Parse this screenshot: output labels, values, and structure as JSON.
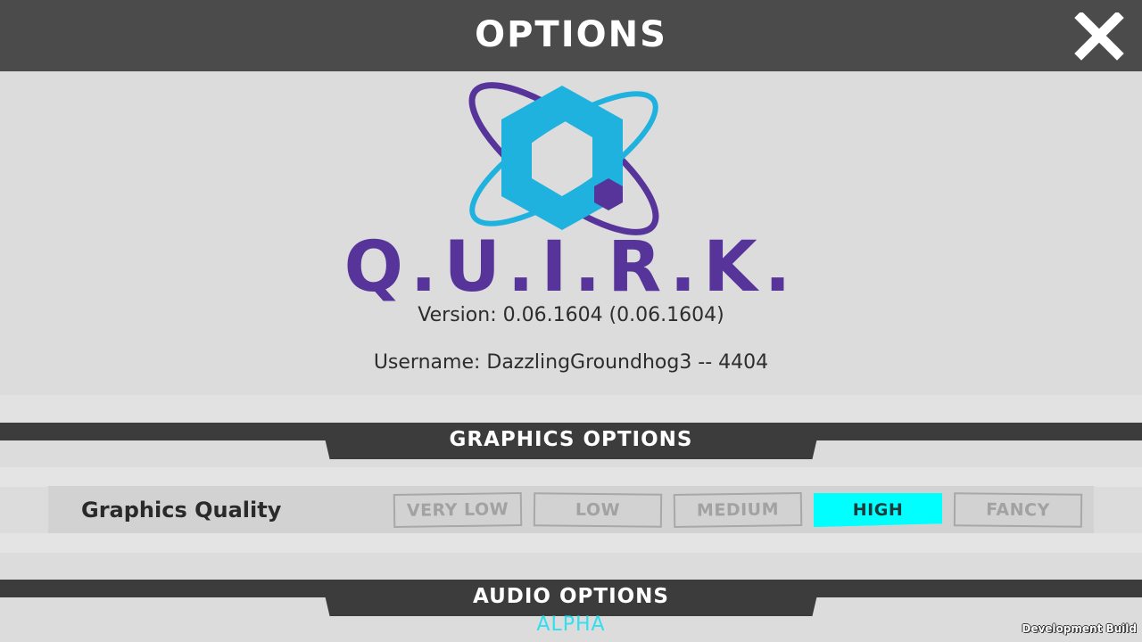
{
  "header": {
    "title": "OPTIONS"
  },
  "logo": {
    "wordmark": "Q.U.I.R.K."
  },
  "info": {
    "version": "Version: 0.06.1604 (0.06.1604)",
    "username": "Username: DazzlingGroundhog3 -- 4404"
  },
  "graphics": {
    "section_title": "GRAPHICS OPTIONS",
    "quality_label": "Graphics Quality",
    "options": [
      "VERY LOW",
      "LOW",
      "MEDIUM",
      "HIGH",
      "FANCY"
    ],
    "selected": "HIGH"
  },
  "audio": {
    "section_title": "AUDIO OPTIONS"
  },
  "footer": {
    "stage": "ALPHA",
    "build": "Development Build"
  },
  "colors": {
    "accent": "#00ffff",
    "logo_blue": "#1fb2de",
    "logo_purple": "#56349a",
    "header_bg": "#4b4b4b"
  },
  "icons": {
    "close": "close-icon"
  }
}
